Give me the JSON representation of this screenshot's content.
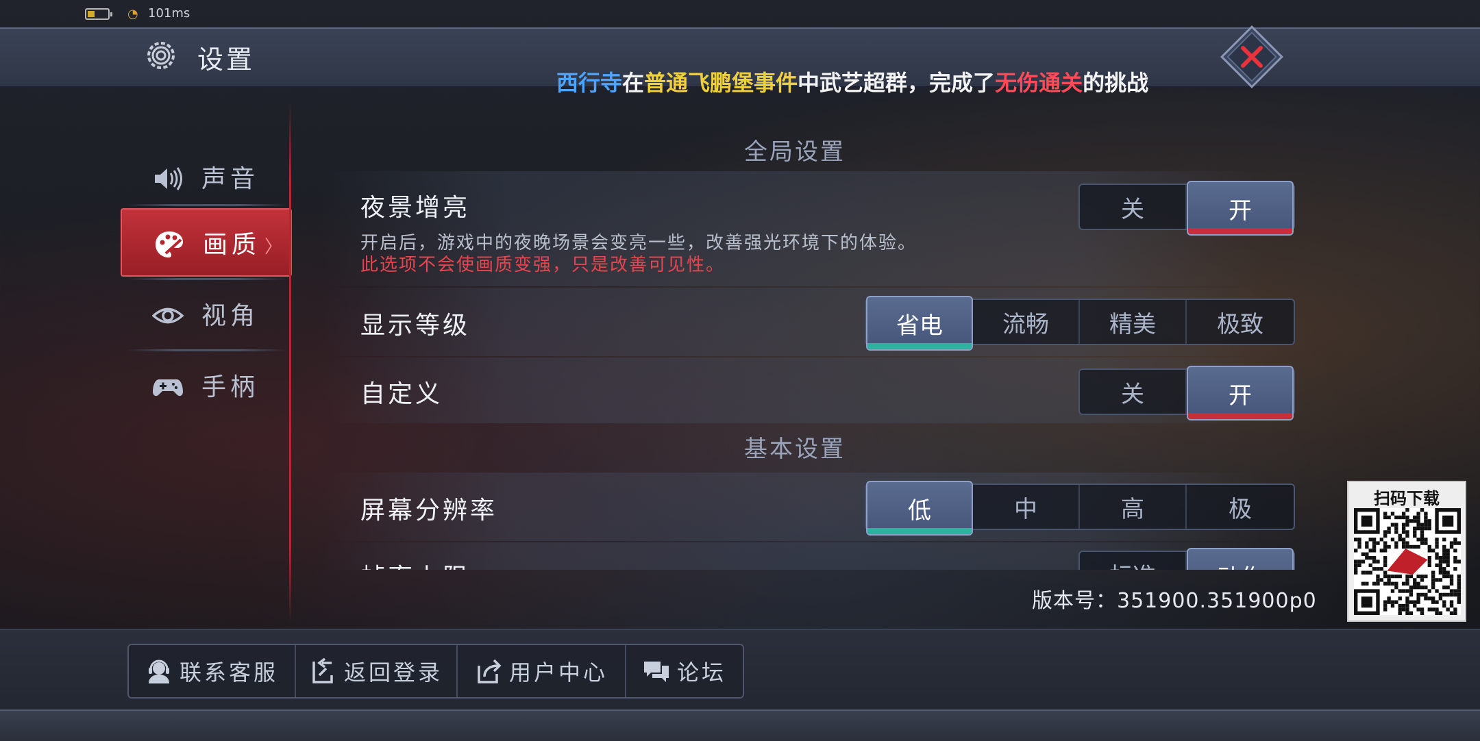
{
  "status": {
    "ping": "101ms",
    "battery_level": 0.35
  },
  "header": {
    "title": "设置",
    "ticker": {
      "player": "西行寺",
      "t1": "在",
      "event": "普通飞鹏堡事件",
      "t2": "中武艺超群，完成了",
      "achievement": "无伤通关",
      "t3": "的挑战"
    }
  },
  "sidebar": {
    "items": [
      {
        "label": "声音",
        "icon": "speaker-icon"
      },
      {
        "label": "画质",
        "icon": "palette-icon",
        "active": true
      },
      {
        "label": "视角",
        "icon": "eye-icon"
      },
      {
        "label": "手柄",
        "icon": "gamepad-icon"
      }
    ]
  },
  "sections": {
    "global": "全局设置",
    "basic": "基本设置"
  },
  "settings": {
    "night": {
      "label": "夜景增亮",
      "desc": "开启后，游戏中的夜晚场景会变亮一些，改善强光环境下的体验。",
      "warn": "此选项不会使画质变强，只是改善可见性。",
      "off": "关",
      "on": "开",
      "selected": "开"
    },
    "display": {
      "label": "显示等级",
      "options": [
        "省电",
        "流畅",
        "精美",
        "极致"
      ],
      "selected": "省电"
    },
    "custom": {
      "label": "自定义",
      "off": "关",
      "on": "开",
      "selected": "开"
    },
    "resolution": {
      "label": "屏幕分辨率",
      "options": [
        "低",
        "中",
        "高",
        "极"
      ],
      "selected": "低"
    },
    "framerate": {
      "label": "帧率上限",
      "options": [
        "标准",
        "动作"
      ],
      "selected": "动作"
    }
  },
  "version": "版本号：351900.351900p0",
  "qr": {
    "title": "扫码下载"
  },
  "footer": {
    "support": "联系客服",
    "back_login": "返回登录",
    "user_center": "用户中心",
    "forum": "论坛"
  },
  "colors": {
    "accent_red": "#c73038",
    "accent_teal": "#2bb3a0",
    "selected_blue": "#5a6b90",
    "ticker_blue": "#4ea3ff",
    "ticker_yellow": "#f0d038",
    "ticker_red": "#ff4a58"
  }
}
